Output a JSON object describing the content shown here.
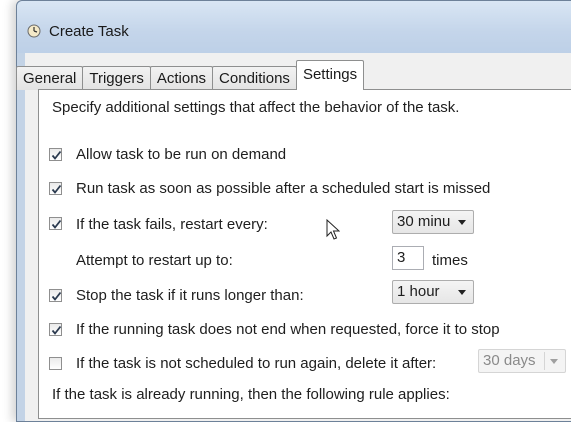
{
  "window": {
    "title": "Create Task"
  },
  "tabs": [
    {
      "label": "General"
    },
    {
      "label": "Triggers"
    },
    {
      "label": "Actions"
    },
    {
      "label": "Conditions"
    },
    {
      "label": "Settings",
      "active": true
    }
  ],
  "settings": {
    "intro": "Specify additional settings that affect the behavior of the task.",
    "allow_on_demand": {
      "label": "Allow task to be run on demand",
      "checked": true
    },
    "run_asap": {
      "label": "Run task as soon as possible after a scheduled start is missed",
      "checked": true
    },
    "restart_on_fail": {
      "label": "If the task fails, restart every:",
      "checked": true,
      "interval": "30 minu"
    },
    "restart_attempts": {
      "label": "Attempt to restart up to:",
      "value": "3",
      "suffix": "times"
    },
    "stop_if_long": {
      "label": "Stop the task if it runs longer than:",
      "checked": true,
      "duration": "1 hour"
    },
    "force_stop": {
      "label": "If the running task does not end when requested, force it to stop",
      "checked": true
    },
    "delete_after": {
      "label": "If the task is not scheduled to run again, delete it after:",
      "checked": false,
      "value": "30 days"
    },
    "running_rule": {
      "label": "If the task is already running, then the following rule applies:"
    }
  },
  "icons": {
    "title": "clock-icon",
    "cursor": "mouse-pointer-icon"
  },
  "colors": {
    "check": "#2b3a4f",
    "window_frame": "#c3d3e6"
  }
}
